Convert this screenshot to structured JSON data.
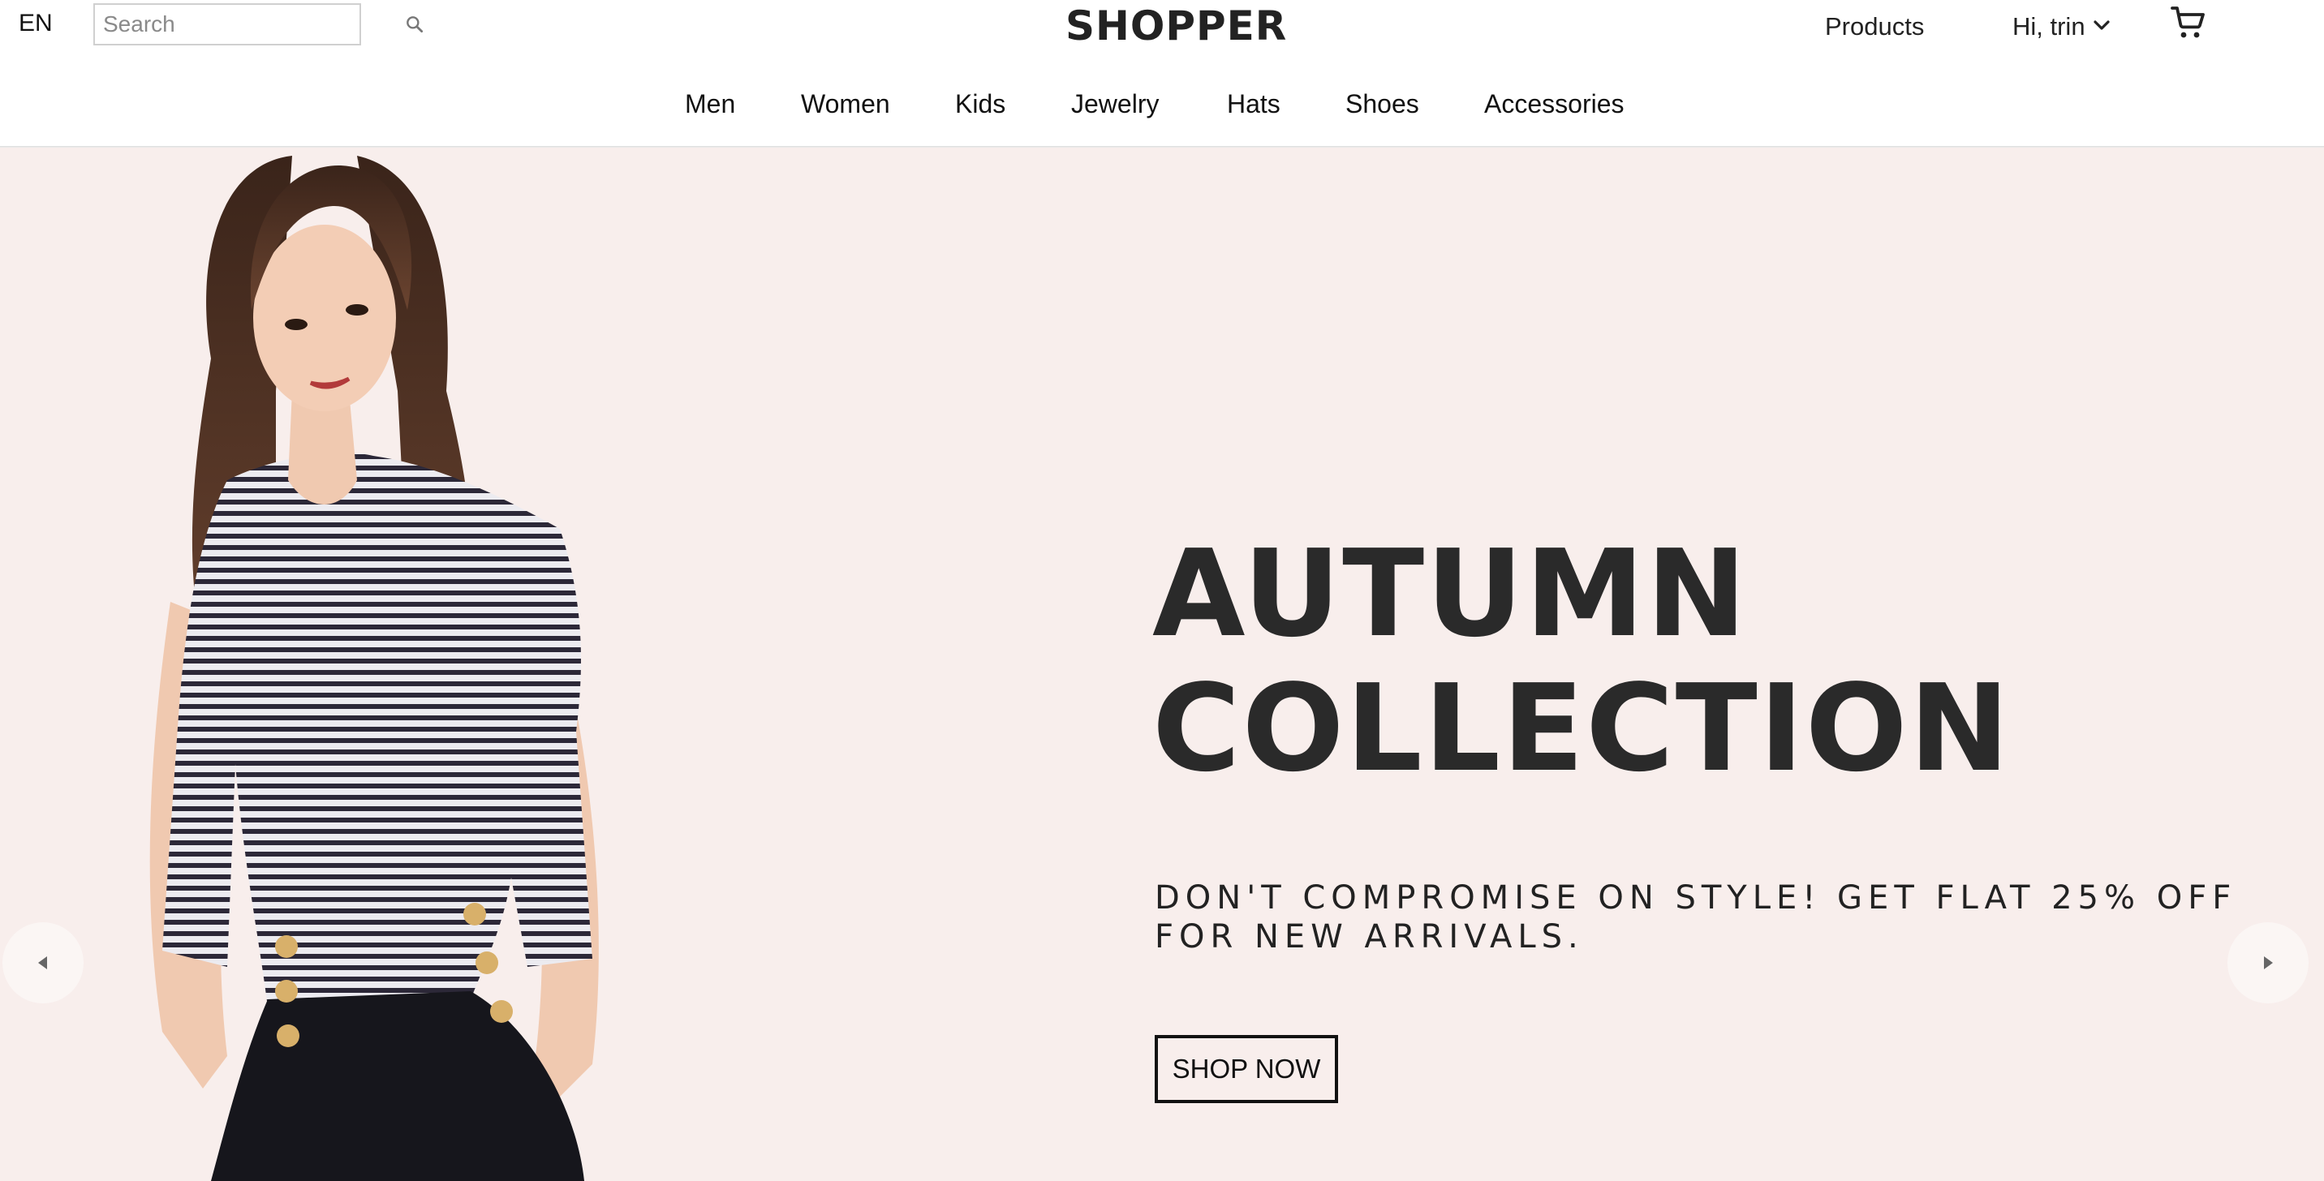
{
  "header": {
    "language": "EN",
    "search": {
      "placeholder": "Search",
      "value": ""
    },
    "logo": "SHOPPER",
    "products_label": "Products",
    "user_greeting": "Hi, trin"
  },
  "categories": [
    {
      "label": "Men"
    },
    {
      "label": "Women"
    },
    {
      "label": "Kids"
    },
    {
      "label": "Jewelry"
    },
    {
      "label": "Hats"
    },
    {
      "label": "Shoes"
    },
    {
      "label": "Accessories"
    }
  ],
  "hero": {
    "title_line1": "AUTUMN",
    "title_line2": "COLLECTION",
    "subtitle": "DON'T COMPROMISE ON STYLE! GET FLAT 25% OFF FOR NEW ARRIVALS.",
    "cta_label": "SHOP NOW",
    "background_color": "#f8eeec"
  },
  "icons": {
    "search": "search-icon",
    "dropdown": "chevron-down-icon",
    "cart": "shopping-cart-icon",
    "prev": "arrow-left-icon",
    "next": "arrow-right-icon"
  }
}
